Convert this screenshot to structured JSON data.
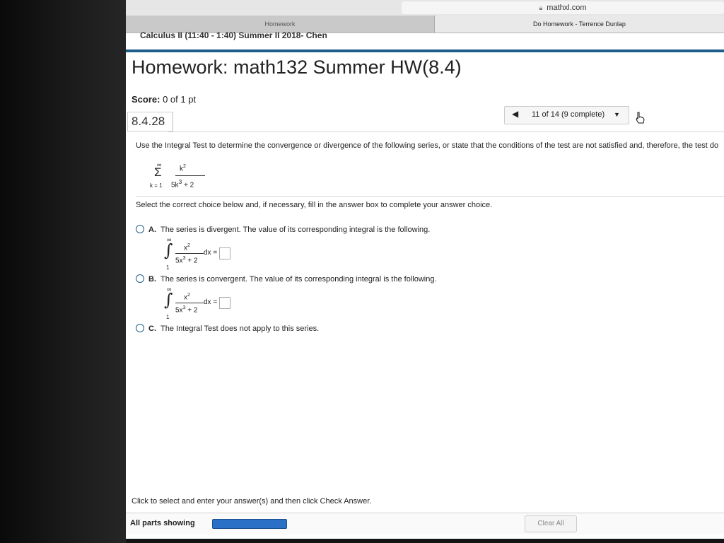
{
  "browser": {
    "url": "mathxl.com",
    "tabs": [
      {
        "label": "Homework"
      },
      {
        "label": "Do Homework - Terrence Dunlap"
      }
    ]
  },
  "course": {
    "title": "Calculus II (11:40 - 1:40) Summer II 2018- Chen"
  },
  "homework": {
    "title": "Homework: math132 Summer HW(8.4)"
  },
  "score": {
    "label": "Score:",
    "value": "0 of 1 pt"
  },
  "question": {
    "number": "8.4.28",
    "nav_label": "11 of 14 (9 complete)",
    "instruction": "Use the Integral Test to determine the convergence or divergence of the following series, or state that the conditions of the test are not satisfied and, therefore, the test do",
    "series": {
      "upper": "∞",
      "sigma": "Σ",
      "lower": "k = 1",
      "numerator": "k",
      "num_exp": "2",
      "denominator": "5k",
      "den_exp": "3",
      "den_rest": "+ 2"
    },
    "select_text": "Select the correct choice below and, if necessary, fill in the answer box to complete your answer choice.",
    "choices": [
      {
        "letter": "A.",
        "text": "The series is divergent. The value of its corresponding integral is the following."
      },
      {
        "letter": "B.",
        "text": "The series is convergent. The value of its corresponding integral is the following."
      },
      {
        "letter": "C.",
        "text": "The Integral Test does not apply to this series."
      }
    ],
    "integral": {
      "upper": "∞",
      "sign": "∫",
      "lower": "1",
      "numerator": "x",
      "num_exp": "2",
      "denominator": "5x",
      "den_exp": "3",
      "den_rest": "+ 2",
      "dx": "dx ="
    }
  },
  "footer": {
    "message": "Click to select and enter your answer(s) and then click Check Answer.",
    "parts_label": "All parts showing",
    "clear_label": "Clear All",
    "progress": 1.0
  },
  "colors": {
    "accent": "#1d5f8a",
    "progress": "#2a70c7"
  },
  "icons": {
    "lock": "lock-icon",
    "prev": "triangle-left-icon",
    "dropdown": "triangle-down-icon",
    "cursor": "hand-pointer-icon"
  }
}
